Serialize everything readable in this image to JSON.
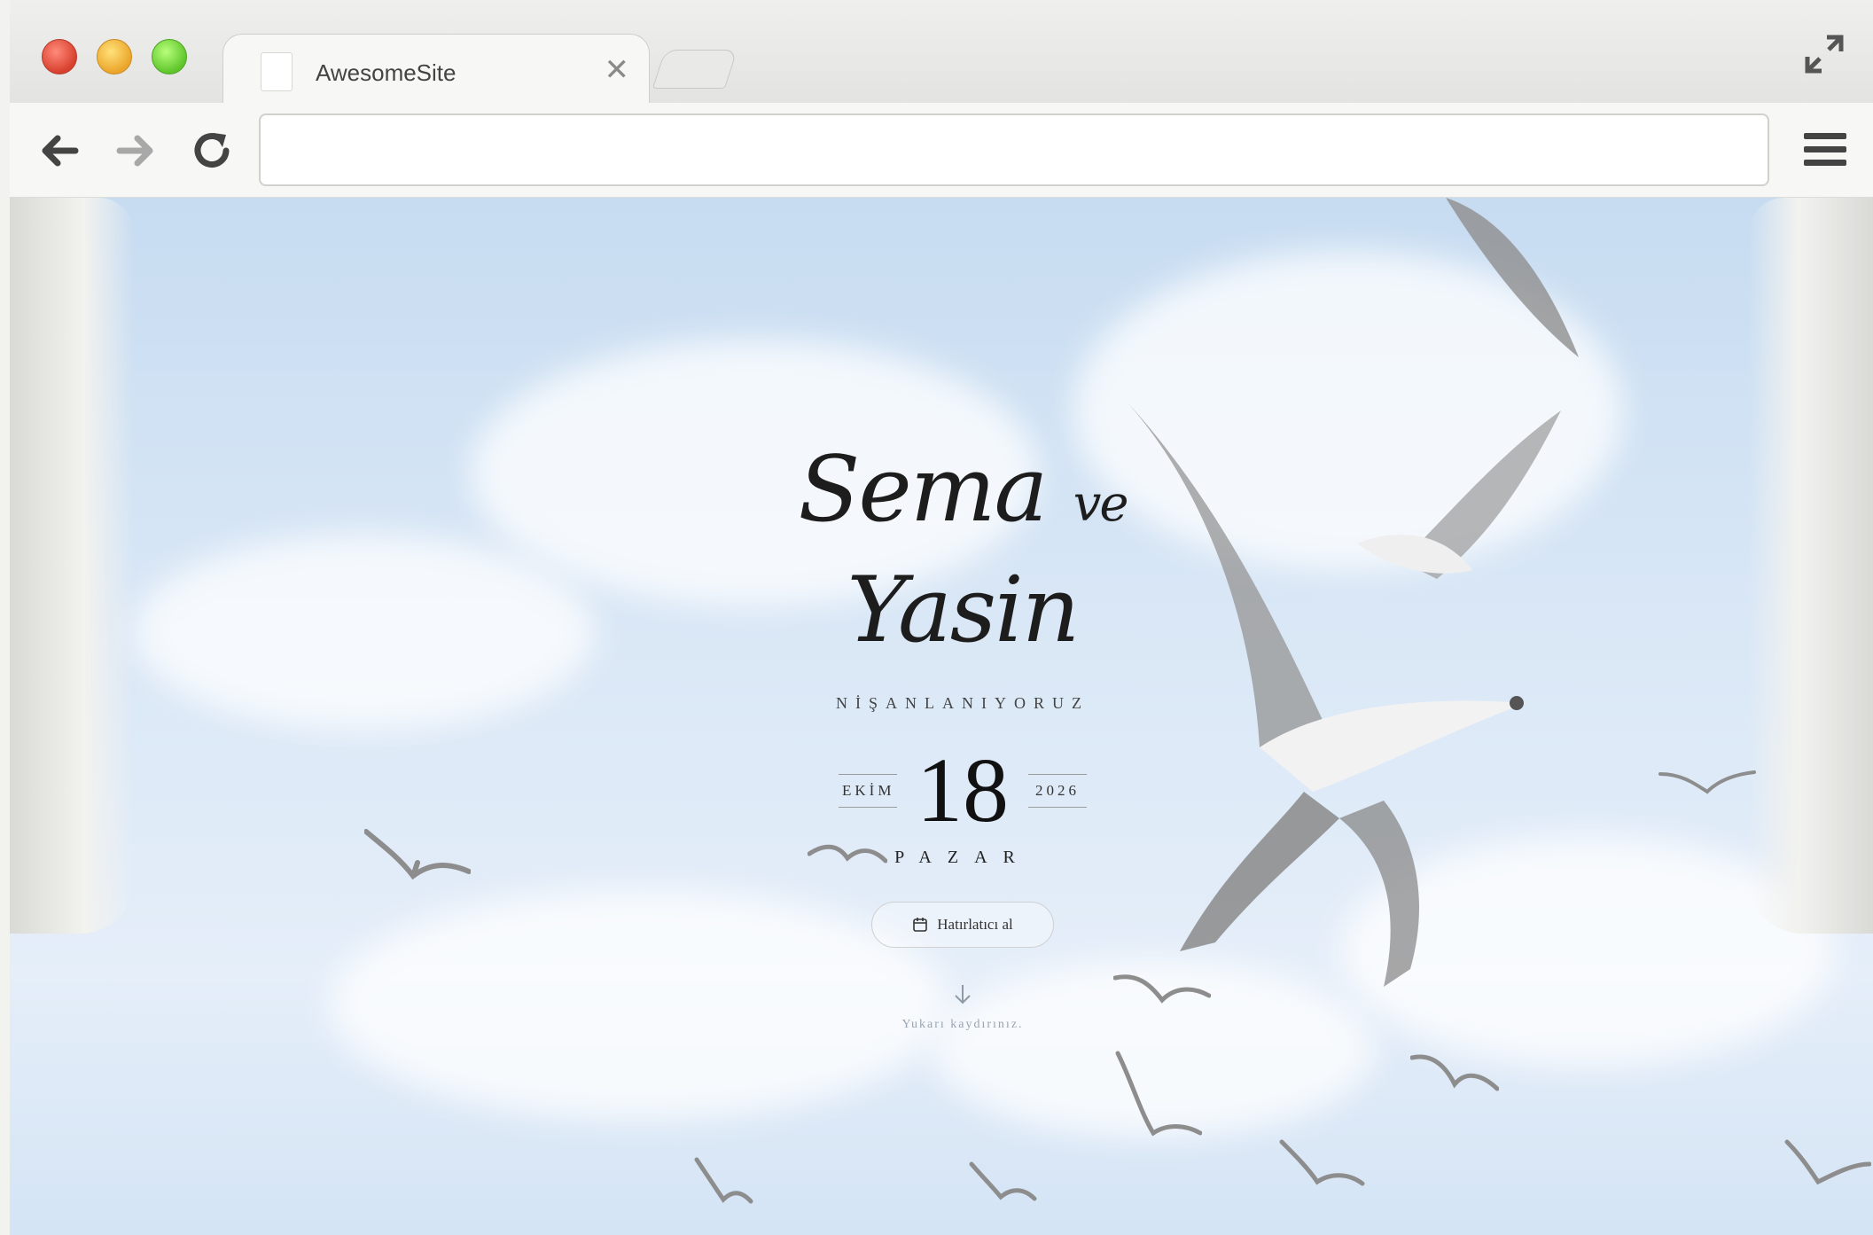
{
  "browser": {
    "tab_title": "AwesomeSite",
    "url_value": ""
  },
  "invitation": {
    "name1": "Sema",
    "connector": "ve",
    "name2": "Yasin",
    "subtitle": "NİŞANLANIYORUZ",
    "month": "EKİM",
    "day": "18",
    "year": "2026",
    "weekday": "PAZAR",
    "reminder_label": "Hatırlatıcı al",
    "scroll_hint": "Yukarı kaydırınız."
  },
  "colors": {
    "sky": "#d9e7f6",
    "text": "#1d1d1d"
  },
  "icons": [
    "close-icon",
    "back-icon",
    "forward-icon",
    "reload-icon",
    "menu-icon",
    "fullscreen-icon",
    "calendar-icon",
    "arrow-down-icon",
    "bird-icon"
  ]
}
